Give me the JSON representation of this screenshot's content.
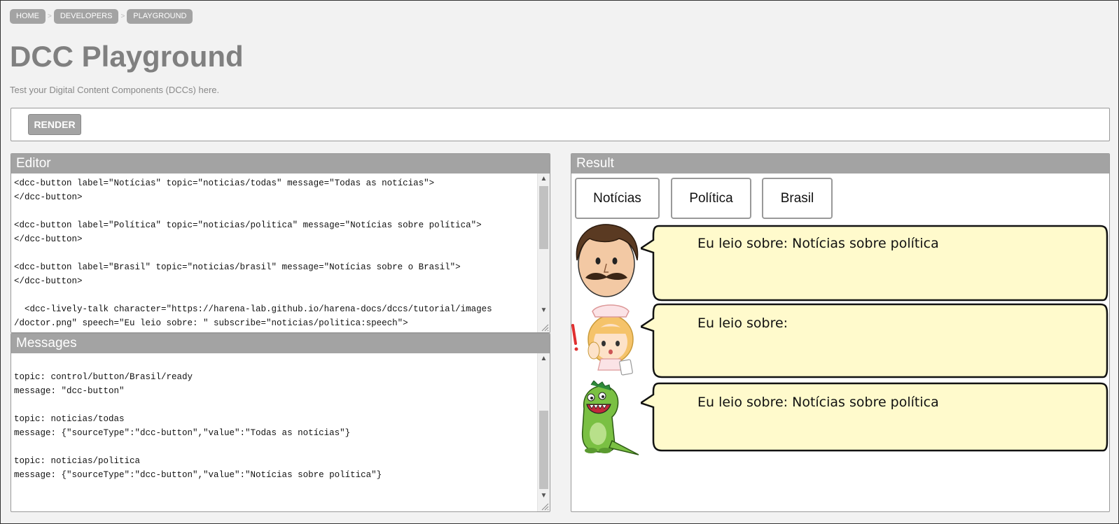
{
  "breadcrumb": [
    "HOME",
    "DEVELOPERS",
    "PLAYGROUND"
  ],
  "breadcrumb_sep": ">",
  "title": "DCC Playground",
  "subtitle": "Test your Digital Content Components (DCCs) here.",
  "toolbar": {
    "render_label": "RENDER"
  },
  "editor": {
    "header": "Editor",
    "code": "<dcc-button label=\"Notícias\" topic=\"noticias/todas\" message=\"Todas as notícias\">\n</dcc-button>\n\n<dcc-button label=\"Política\" topic=\"noticias/politica\" message=\"Notícias sobre política\">\n</dcc-button>\n\n<dcc-button label=\"Brasil\" topic=\"noticias/brasil\" message=\"Notícias sobre o Brasil\">\n</dcc-button>\n\n  <dcc-lively-talk character=\"https://harena-lab.github.io/harena-docs/dccs/tutorial/images\n/doctor.png\" speech=\"Eu leio sobre: \" subscribe=\"noticias/politica:speech\">"
  },
  "messages": {
    "header": "Messages",
    "log": "topic: control/button/Brasil/ready\nmessage: \"dcc-button\"\n\ntopic: noticias/todas\nmessage: {\"sourceType\":\"dcc-button\",\"value\":\"Todas as notícias\"}\n\ntopic: noticias/politica\nmessage: {\"sourceType\":\"dcc-button\",\"value\":\"Notícias sobre política\"}"
  },
  "result": {
    "header": "Result",
    "buttons": [
      "Notícias",
      "Política",
      "Brasil"
    ],
    "talks": [
      {
        "character": "doctor-icon",
        "speech": "Eu leio sobre: Notícias sobre política"
      },
      {
        "character": "nurse-icon",
        "speech": "Eu leio sobre:"
      },
      {
        "character": "dinosaur-icon",
        "speech": "Eu leio sobre: Notícias sobre política"
      }
    ]
  },
  "colors": {
    "header_bg": "#a3a3a3",
    "bubble_fill": "#fffacc",
    "page_bg": "#f2f2f2"
  }
}
